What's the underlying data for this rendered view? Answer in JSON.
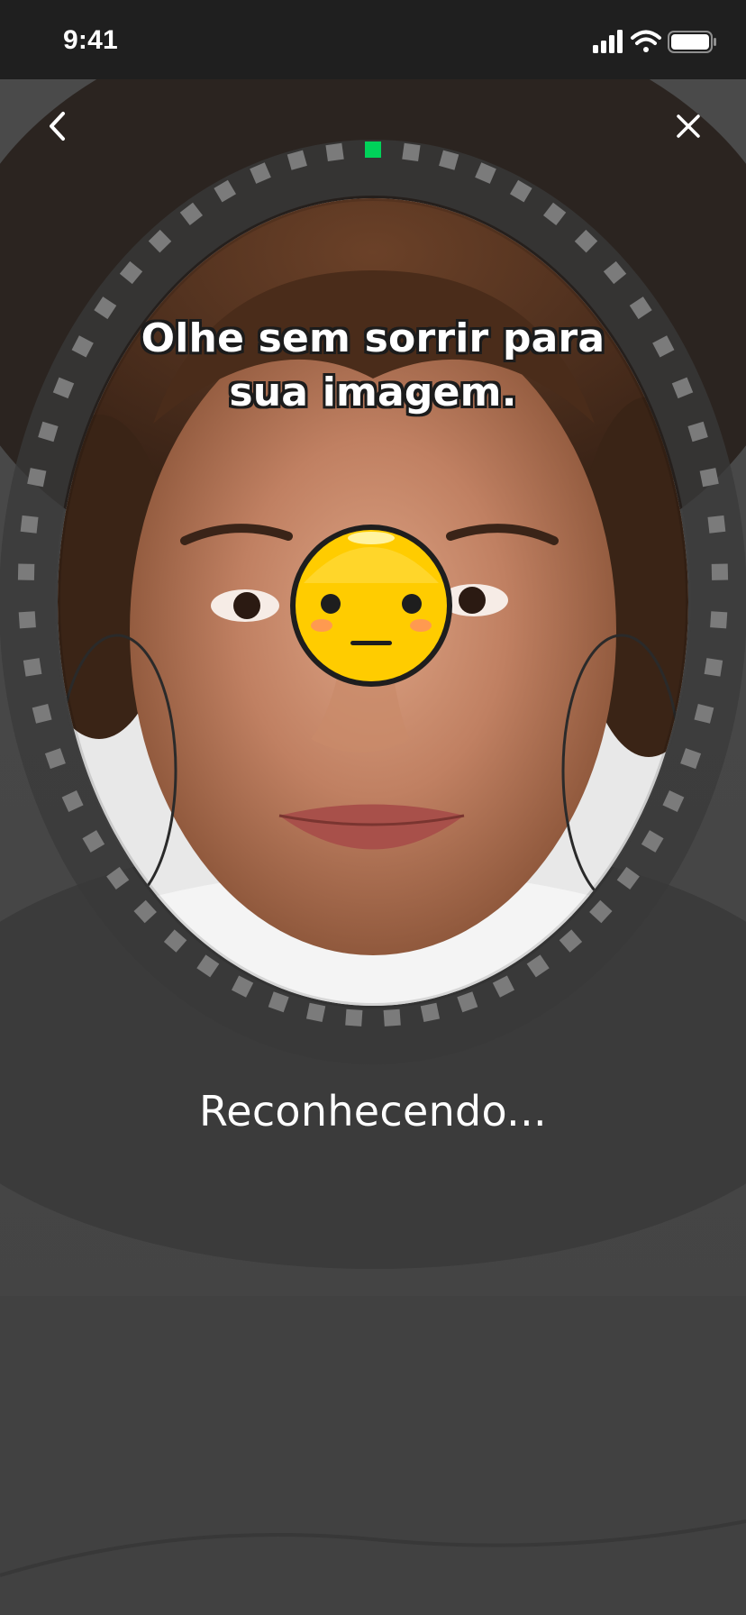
{
  "status_bar": {
    "time": "9:41",
    "icons": [
      "cellular-signal-icon",
      "wifi-icon",
      "battery-icon"
    ]
  },
  "nav": {
    "back_icon": "chevron-left-icon",
    "close_icon": "close-icon"
  },
  "capture": {
    "instruction_line1": "Olhe sem sorrir para",
    "instruction_line2": "sua imagem.",
    "status": "Reconhecendo...",
    "expression_icon": "neutral-face-emoji-icon",
    "progress_fraction": 0.0175
  },
  "colors": {
    "accent": "#00d25a",
    "frame_background": "#444444",
    "status_bar": "#1f1f1f",
    "text": "#ffffff",
    "emoji": "#ffcc00"
  }
}
